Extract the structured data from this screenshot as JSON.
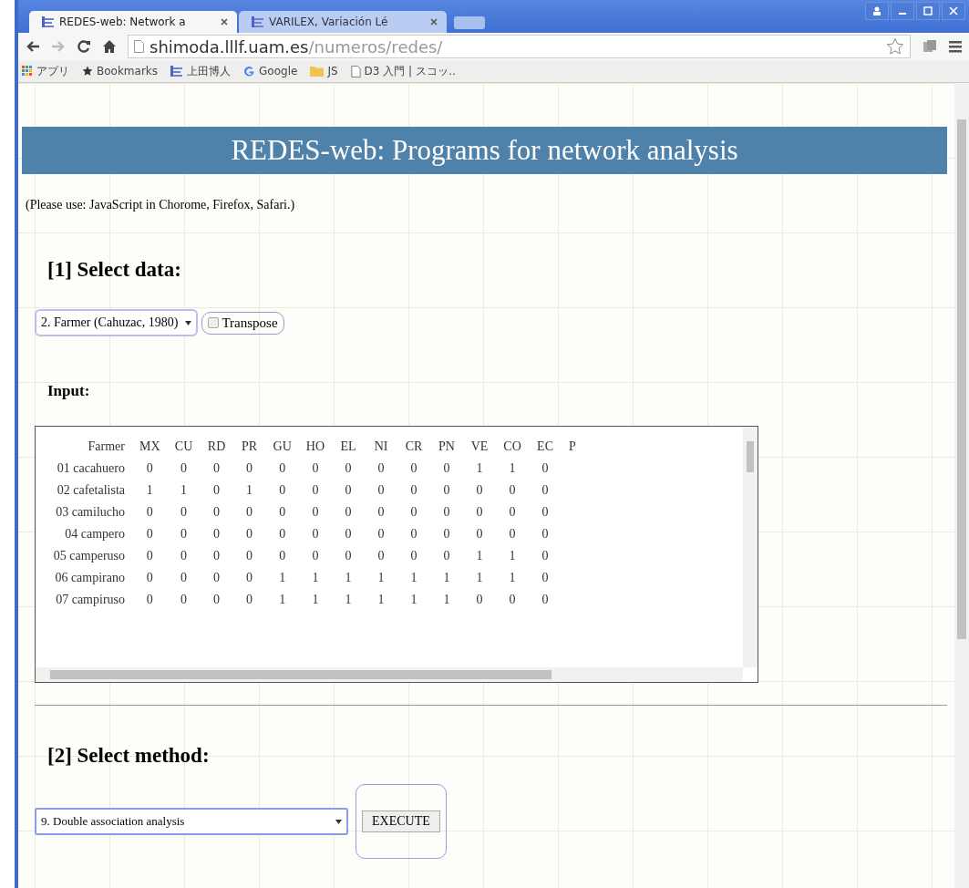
{
  "browser": {
    "tabs": [
      {
        "title": "REDES-web: Network a",
        "selected": true
      },
      {
        "title": "VARILEX, Variación Lé",
        "selected": false
      }
    ],
    "address": {
      "host": "shimoda.lllf.uam.es",
      "path": "/numeros/redes/"
    },
    "bookmarks": [
      {
        "kind": "apps",
        "label": "アプリ"
      },
      {
        "kind": "star",
        "label": "Bookmarks"
      },
      {
        "kind": "site",
        "label": "上田博人"
      },
      {
        "kind": "google",
        "label": "Google"
      },
      {
        "kind": "folder",
        "label": "JS"
      },
      {
        "kind": "page",
        "label": "D3 入門 | スコッ‥"
      }
    ]
  },
  "page": {
    "header": "REDES-web: Programs for network analysis",
    "note": "(Please use: JavaScript in Chorome, Firefox, Safari.)",
    "section1": {
      "title": "[1] Select data:",
      "data_select": "2. Farmer (Cahuzac, 1980)",
      "transpose": {
        "label": "Transpose",
        "checked": false
      },
      "input_label": "Input:",
      "table": {
        "columns": [
          "Farmer",
          "MX",
          "CU",
          "RD",
          "PR",
          "GU",
          "HO",
          "EL",
          "NI",
          "CR",
          "PN",
          "VE",
          "CO",
          "EC",
          "P"
        ],
        "rows": [
          [
            "01 cacahuero",
            "0",
            "0",
            "0",
            "0",
            "0",
            "0",
            "0",
            "0",
            "0",
            "0",
            "1",
            "1",
            "0"
          ],
          [
            "02 cafetalista",
            "1",
            "1",
            "0",
            "1",
            "0",
            "0",
            "0",
            "0",
            "0",
            "0",
            "0",
            "0",
            "0"
          ],
          [
            "03 camilucho",
            "0",
            "0",
            "0",
            "0",
            "0",
            "0",
            "0",
            "0",
            "0",
            "0",
            "0",
            "0",
            "0"
          ],
          [
            "04 campero",
            "0",
            "0",
            "0",
            "0",
            "0",
            "0",
            "0",
            "0",
            "0",
            "0",
            "0",
            "0",
            "0"
          ],
          [
            "05 camperuso",
            "0",
            "0",
            "0",
            "0",
            "0",
            "0",
            "0",
            "0",
            "0",
            "0",
            "1",
            "1",
            "0"
          ],
          [
            "06 campirano",
            "0",
            "0",
            "0",
            "0",
            "1",
            "1",
            "1",
            "1",
            "1",
            "1",
            "1",
            "1",
            "0"
          ],
          [
            "07 campiruso",
            "0",
            "0",
            "0",
            "0",
            "1",
            "1",
            "1",
            "1",
            "1",
            "1",
            "0",
            "0",
            "0"
          ]
        ]
      }
    },
    "section2": {
      "title": "[2] Select method:",
      "method_select": "9. Double association analysis",
      "execute": "EXECUTE"
    }
  }
}
